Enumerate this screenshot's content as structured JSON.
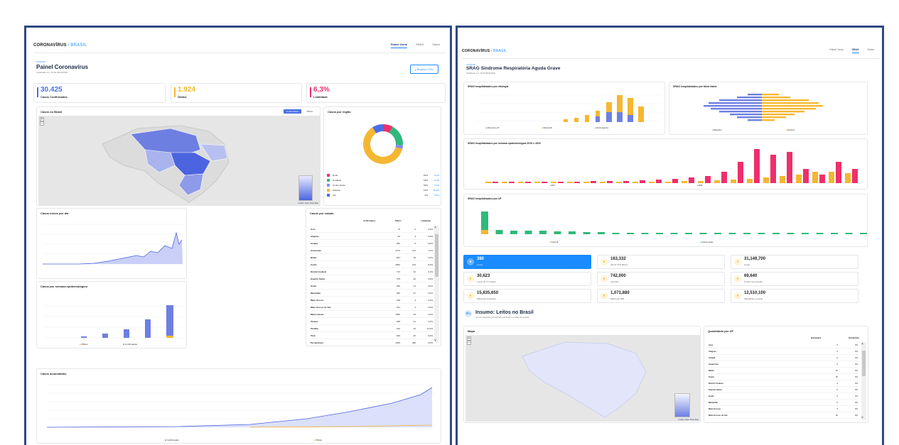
{
  "left": {
    "brand1": "CORONAVÍRUS",
    "sep": "/",
    "brand2": "BRASIL",
    "tabs": [
      "Painel Geral",
      "SRAG",
      "Sobre"
    ],
    "kicker": "COVID19",
    "title": "Painel Coronavírus",
    "updated": "Atualizado em: 16:00 06/04/2020",
    "csv_button": "Arquivo CSV",
    "kpis": [
      {
        "value": "30.425",
        "label": "Casos Confirmados",
        "color": "#4a6fe8"
      },
      {
        "value": "1.924",
        "label": "Óbitos",
        "color": "#f5b731"
      },
      {
        "value": "6,3%",
        "label": "Letalidade",
        "color": "#ef2f6b"
      }
    ],
    "map_card": {
      "title": "Casos no Brasil",
      "toggle_active": "Confirmados",
      "toggle_inactive": "Óbitos",
      "attribution": "Leaflet | Open Street Map"
    },
    "region_card": {
      "title": "Casos por região",
      "regions": [
        {
          "name": "Norte",
          "pct": "22%",
          "pct2": "0,0%",
          "color": "#ef2f6b"
        },
        {
          "name": "Nordeste",
          "pct": "15%",
          "pct2": "0,0%",
          "color": "#2fb97a"
        },
        {
          "name": "Centro-Oeste",
          "pct": "53%",
          "pct2": "0,0%",
          "color": "#8a8af0"
        },
        {
          "name": "Sudeste",
          "pct": "10%",
          "pct2": "55,0%",
          "color": "#f5b731"
        },
        {
          "name": "Sul",
          "pct": "0%",
          "pct2": "0,0%",
          "color": "#4a6fe8"
        }
      ],
      "donut_fractions": [
        0.08,
        0.18,
        0.03,
        0.62,
        0.09
      ]
    },
    "new_cases_card": {
      "title": "Casos novos por dia"
    },
    "state_card": {
      "title": "Casos por estado",
      "headers": [
        "Confirmados",
        "Óbitos",
        "Letalidade"
      ],
      "rows": [
        [
          "Acre",
          "70",
          "4",
          "4,3%"
        ],
        [
          "Alagoas",
          "36",
          "3",
          "0,0%"
        ],
        [
          "Amapá",
          "262",
          "9",
          "0,0%"
        ],
        [
          "Amazonas",
          "1719",
          "124",
          "7,2%"
        ],
        [
          "Bahia",
          "961",
          "29",
          "3,0%"
        ],
        [
          "Ceará",
          "2084",
          "124",
          "6,0%"
        ],
        [
          "Distrito Federal",
          "710",
          "23",
          "3,2%"
        ],
        [
          "Espírito Santo",
          "704",
          "22",
          "3,6%"
        ],
        [
          "Goiás",
          "336",
          "14",
          "0,0%"
        ],
        [
          "Maranhão",
          "926",
          "37",
          "0,0%"
        ],
        [
          "Mato Grosso",
          "190",
          "4",
          "2,2%"
        ],
        [
          "Mato Grosso do Sul",
          "151",
          "4",
          "0,0%"
        ],
        [
          "Minas Gerais",
          "1090",
          "33",
          "3,0%"
        ],
        [
          "Paraná",
          "928",
          "41",
          "4,2%"
        ],
        [
          "Paraíba",
          "162",
          "24",
          "14,3%"
        ],
        [
          "Pará",
          "632",
          "25",
          "0,0%"
        ],
        [
          "Pernambuco",
          "1520",
          "482",
          "0,0%"
        ]
      ]
    },
    "week_card": {
      "title": "Casos por semana epidemiológica",
      "legend": [
        "Óbitos",
        "Confirmados"
      ]
    },
    "acc_card": {
      "title": "Casos acumulados",
      "legend": [
        "Confirmados",
        "Óbitos"
      ]
    }
  },
  "right": {
    "brand1": "CORONAVÍRUS",
    "sep": "/",
    "brand2": "BRASIL",
    "tabs": [
      "Painel Geral",
      "SRAG",
      "Sobre"
    ],
    "kicker": "COVID19",
    "title": "SRAG Síndrome Respiratória Aguda Grave",
    "updated": "Atualizado em: 16:00 06/04/2020",
    "etiology": {
      "title": "SRAG hospitalizados por etiologia",
      "legend": [
        "Influenza A e B",
        "Influenza B",
        "Outros agentes"
      ]
    },
    "age": {
      "title": "SRAG hospitalizados por faixa etária",
      "legend": [
        "Masculino",
        "Feminino"
      ]
    },
    "week": {
      "title": "SRAG hospitalizados por semana epidemiológica 2019 x 2020",
      "legend": [
        "2019",
        "2020"
      ]
    },
    "uf": {
      "title": "SRAG hospitalizados por UF",
      "legend": [
        "Covid-19",
        "Outras causas"
      ]
    },
    "stats": [
      {
        "value": "380",
        "label": "Leitos",
        "icon": "bed-icon",
        "highlight": true
      },
      {
        "value": "163,332",
        "label": "Álcool 70% 500ml",
        "icon": "bottle-icon",
        "highlight": false
      },
      {
        "value": "31,149,700",
        "label": "Luvas",
        "icon": "glove-icon",
        "highlight": false
      },
      {
        "value": "30,623",
        "label": "Leitos de UTI adulto",
        "icon": "bed-icon",
        "highlight": false
      },
      {
        "value": "742,000",
        "label": "Aventais",
        "icon": "apron-icon",
        "highlight": false
      },
      {
        "value": "69,640",
        "label": "Óculos de proteção",
        "icon": "goggles-icon",
        "highlight": false
      },
      {
        "value": "15,835,650",
        "label": "Máscaras cirúrgicas",
        "icon": "mask-icon",
        "highlight": false
      },
      {
        "value": "1,071,880",
        "label": "Máscaras N95",
        "icon": "respirator-icon",
        "highlight": false
      },
      {
        "value": "12,510,100",
        "label": "Sapatilhas e toucas",
        "icon": "cap-icon",
        "highlight": false
      }
    ],
    "insumo": {
      "title": "Insumo: Leitos no Brasil",
      "sub": "Insumos adquiridos pelo Ministério da Saúde e enviado aos estados"
    },
    "map_card": {
      "title": "Mapa",
      "attribution": "Leaflet | Open Street Map"
    },
    "uf_table": {
      "title": "Quantidade por UF",
      "headers": [
        "Quantidade",
        "Distribuição"
      ],
      "rows": [
        [
          "Acre",
          "0",
          "0%"
        ],
        [
          "Alagoas",
          "0",
          "0%"
        ],
        [
          "Amapá",
          "0",
          "0%"
        ],
        [
          "Amazonas",
          "0",
          "0%"
        ],
        [
          "Bahia",
          "40",
          "0%"
        ],
        [
          "Ceará",
          "30",
          "0%"
        ],
        [
          "Distrito Federal",
          "0",
          "0%"
        ],
        [
          "Espírito Santo",
          "0",
          "0%"
        ],
        [
          "Goiás",
          "0",
          "0%"
        ],
        [
          "Maranhão",
          "0",
          "0%"
        ],
        [
          "Mato Grosso",
          "0",
          "0%"
        ],
        [
          "Mato Grosso do Sul",
          "30",
          "0%"
        ]
      ]
    }
  }
}
